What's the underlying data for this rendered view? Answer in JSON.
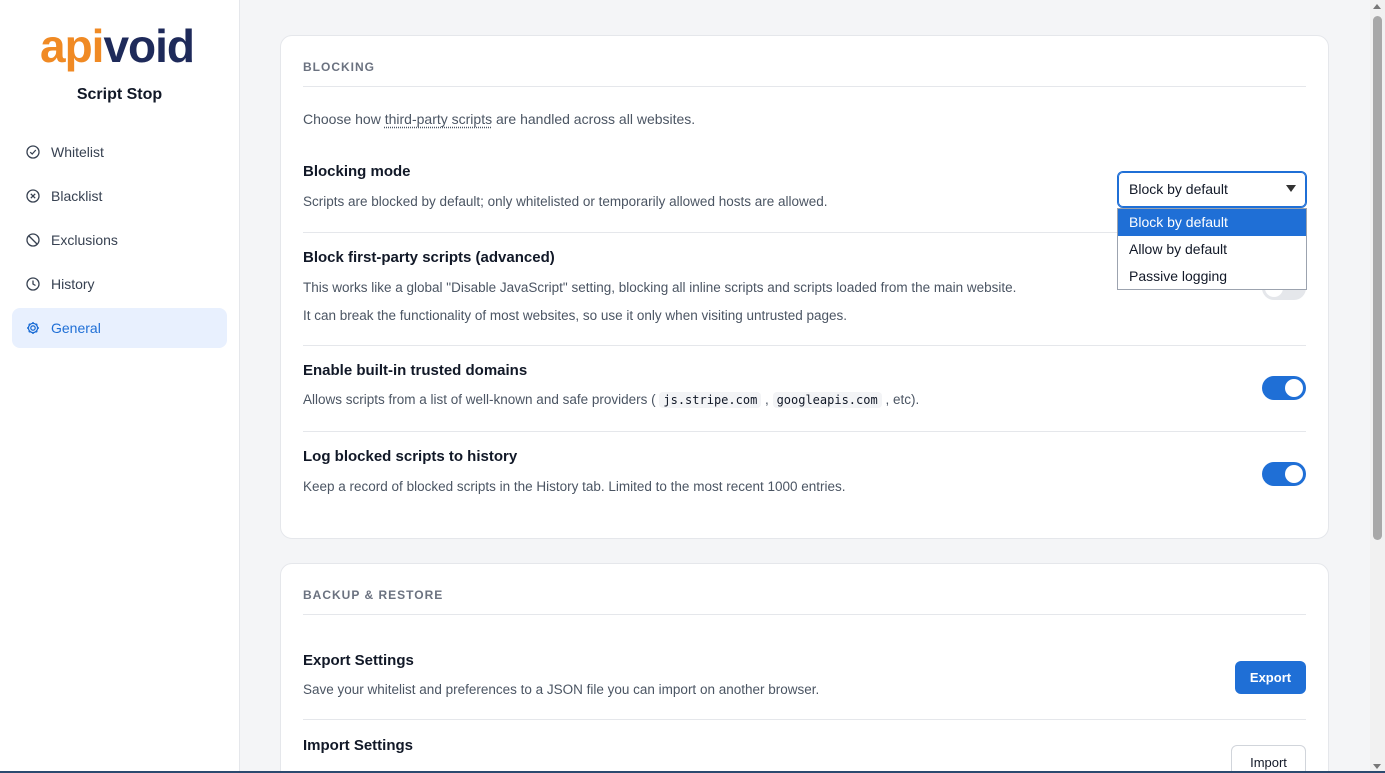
{
  "sidebar": {
    "logo_alt": "apivoid",
    "app_name": "Script Stop",
    "items": [
      {
        "label": "Whitelist",
        "icon": "check-circle-icon"
      },
      {
        "label": "Blacklist",
        "icon": "x-circle-icon"
      },
      {
        "label": "Exclusions",
        "icon": "ban-icon"
      },
      {
        "label": "History",
        "icon": "clock-icon"
      },
      {
        "label": "General",
        "icon": "gear-icon",
        "active": true
      }
    ]
  },
  "blocking": {
    "title": "BLOCKING",
    "intro_pre": "Choose how ",
    "intro_link": "third-party scripts",
    "intro_post": " are handled across all websites.",
    "mode": {
      "title": "Blocking mode",
      "desc": "Scripts are blocked by default; only whitelisted or temporarily allowed hosts are allowed.",
      "selected": "Block by default",
      "options": [
        "Block by default",
        "Allow by default",
        "Passive logging"
      ]
    },
    "first_party": {
      "title": "Block first-party scripts (advanced)",
      "desc1": "This works like a global \"Disable JavaScript\" setting, blocking all inline scripts and scripts loaded from the main website.",
      "desc2": "It can break the functionality of most websites, so use it only when visiting untrusted pages.",
      "enabled": false
    },
    "trusted": {
      "title": "Enable built-in trusted domains",
      "desc_pre": "Allows scripts from a list of well-known and safe providers ( ",
      "code1": "js.stripe.com",
      "sep": " , ",
      "code2": "googleapis.com",
      "desc_post": " , etc).",
      "enabled": true
    },
    "log": {
      "title": "Log blocked scripts to history",
      "desc": "Keep a record of blocked scripts in the History tab. Limited to the most recent 1000 entries.",
      "enabled": true
    }
  },
  "backup": {
    "title": "BACKUP & RESTORE",
    "export": {
      "title": "Export Settings",
      "desc": "Save your whitelist and preferences to a JSON file you can import on another browser.",
      "button": "Export"
    },
    "import": {
      "title": "Import Settings",
      "button": "Import"
    }
  },
  "colors": {
    "accent": "#1f6fd6",
    "logo_orange": "#f08a24",
    "logo_navy": "#1e2a5a"
  }
}
